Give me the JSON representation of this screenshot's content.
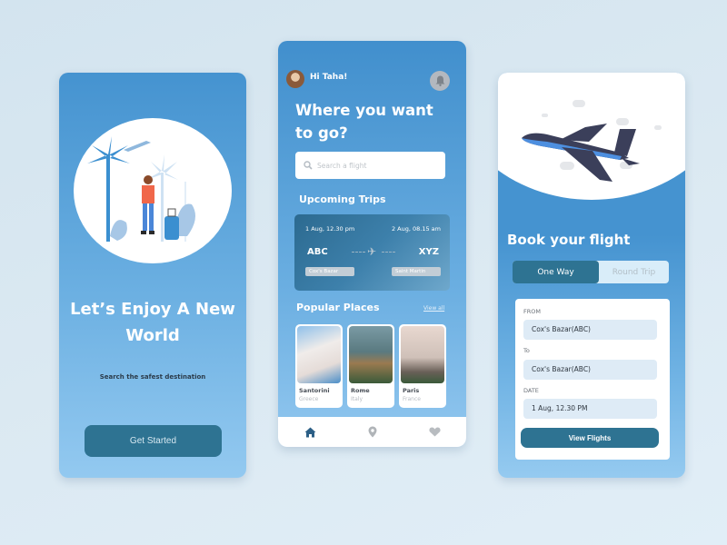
{
  "onboarding": {
    "title": "Let’s Enjoy A New World",
    "subtitle": "Search the safest destination",
    "cta_label": "Get Started"
  },
  "home": {
    "greeting": "Hi Taha!",
    "title": "Where you want to go?",
    "search_placeholder": "Search a flight",
    "upcoming_label": "Upcoming Trips",
    "trip": {
      "depart_time": "1 Aug, 12.30 pm",
      "arrive_time": "2 Aug, 08.15 am",
      "from_code": "ABC",
      "to_code": "XYZ",
      "from_city": "Cox's Bazar",
      "to_city": "Saint Martin"
    },
    "popular_label": "Popular Places",
    "view_all": "View all",
    "places": [
      {
        "name": "Santorini",
        "country": "Greece"
      },
      {
        "name": "Rome",
        "country": "Italy"
      },
      {
        "name": "Paris",
        "country": "France"
      }
    ],
    "nav": [
      "home",
      "location",
      "favorites"
    ]
  },
  "booking": {
    "title": "Book your flight",
    "tabs": [
      "One Way",
      "Round Trip"
    ],
    "active_tab": "One Way",
    "from_label": "FROM",
    "from_value": "Cox's Bazar(ABC)",
    "to_label": "To",
    "to_value": "Cox's Bazar(ABC)",
    "date_label": "DATE",
    "date_value": "1 Aug, 12.30 PM",
    "cta_label": "View Flights"
  },
  "colors": {
    "primary": "#4593d0",
    "button": "#2e7392",
    "nav_active": "#2c5f86"
  }
}
